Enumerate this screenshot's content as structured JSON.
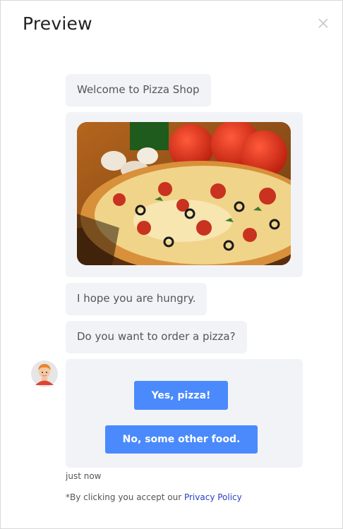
{
  "header": {
    "title": "Preview",
    "close_icon": "close-icon"
  },
  "messages": [
    {
      "text": "Welcome to Pizza Shop"
    },
    {
      "image": "pizza-image"
    },
    {
      "text": "I hope you are hungry."
    },
    {
      "text": "Do you want to order a pizza?"
    }
  ],
  "choices": {
    "yes_label": "Yes, pizza!",
    "no_label": "No, some other food."
  },
  "timestamp": "just now",
  "footer": {
    "prefix": "*By clicking you accept our ",
    "link_label": "Privacy Policy"
  },
  "colors": {
    "accent": "#4a8afc",
    "bubble_bg": "#f2f3f7",
    "link": "#2a3fc7"
  }
}
